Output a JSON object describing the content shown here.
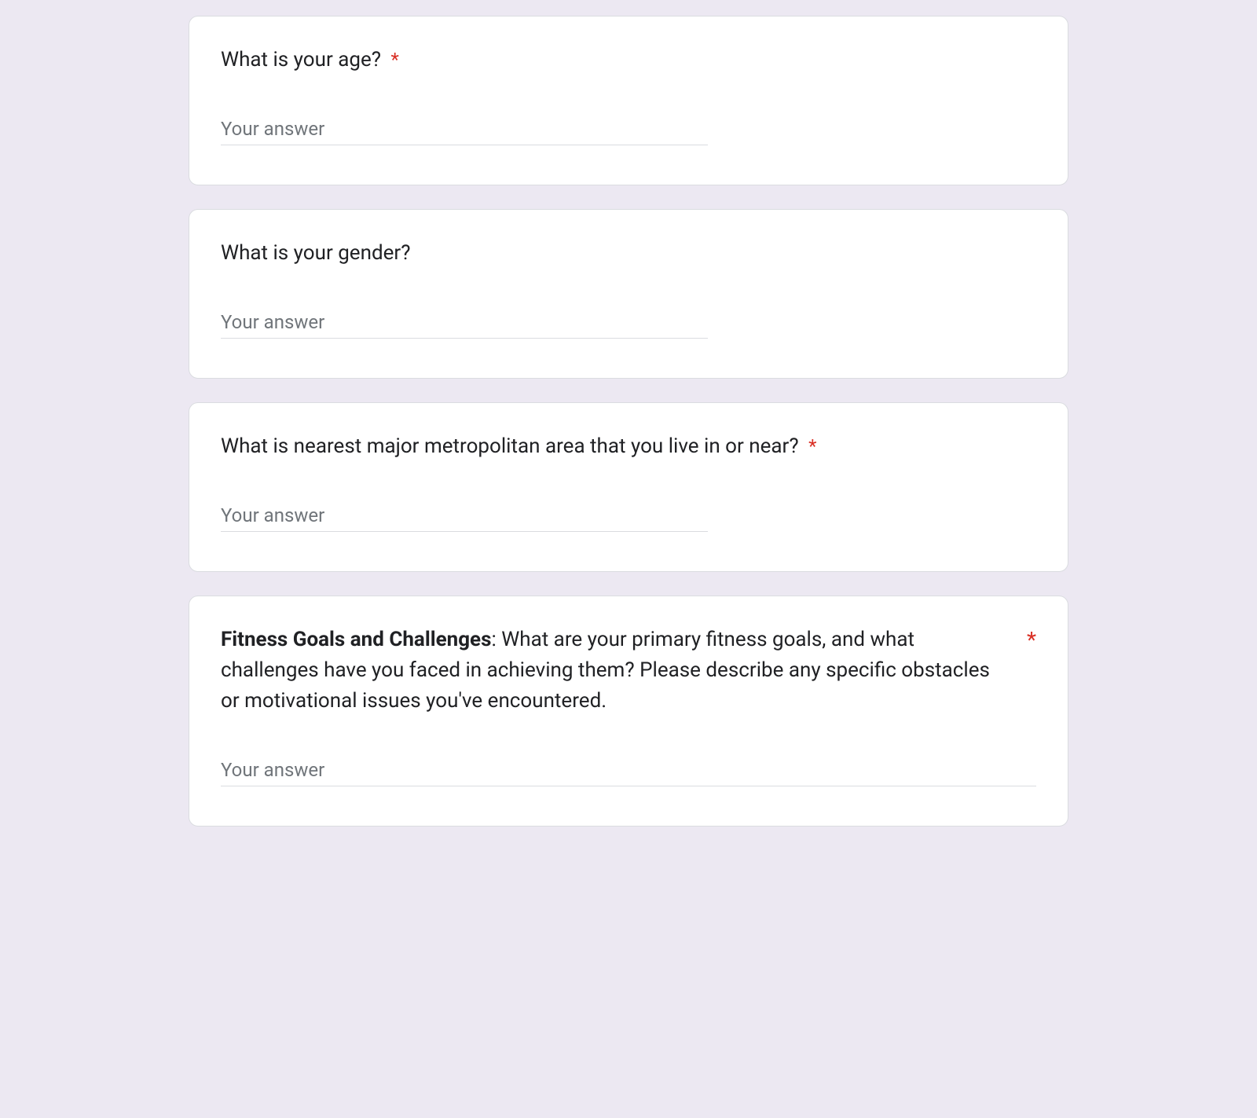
{
  "questions": [
    {
      "label": "What is your age?",
      "required": true,
      "placeholder": "Your answer",
      "wide": false,
      "bold_prefix": null
    },
    {
      "label": "What is your gender?",
      "required": false,
      "placeholder": "Your answer",
      "wide": false,
      "bold_prefix": null
    },
    {
      "label": "What is nearest major metropolitan area that you live in or near?",
      "required": true,
      "placeholder": "Your answer",
      "wide": false,
      "bold_prefix": null
    },
    {
      "bold_prefix": "Fitness Goals and Challenges",
      "label": ": What are your primary fitness goals, and what challenges have you faced in achieving them? Please describe any specific obstacles or motivational issues you've encountered.",
      "required": true,
      "required_right": true,
      "placeholder": "Your answer",
      "wide": true
    }
  ],
  "required_marker": "*"
}
